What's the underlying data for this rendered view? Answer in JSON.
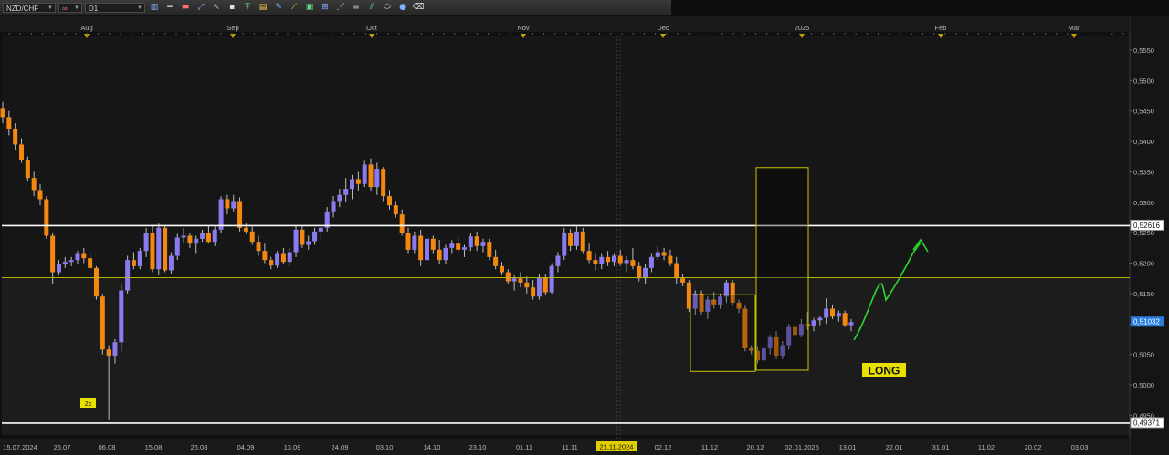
{
  "toolbar": {
    "symbol": "NZD/CHF",
    "timeframe": "D1",
    "icons": [
      "link-icon",
      "chart-type-icon",
      "horizontal-line-icon",
      "color-bar-icon",
      "zoom-icon",
      "cursor-icon",
      "crosshair-icon",
      "text-icon",
      "template-icon",
      "pencil-icon",
      "gann-icon",
      "screenshot-icon",
      "trend-line-icon",
      "dotted-line-icon",
      "fibonacci-icon",
      "channel-icon",
      "ellipse-icon",
      "sphere-icon",
      "eraser-icon"
    ]
  },
  "chart_data": {
    "type": "candlestick",
    "symbol": "NZD/CHF",
    "timeframe": "D1",
    "month_labels": [
      "Aug",
      "Sep",
      "Oct",
      "Nov",
      "Dec",
      "2025",
      "Feb",
      "Mar"
    ],
    "x_tick_labels": [
      "15.07.2024",
      "26.07",
      "06.08",
      "15.08",
      "26.08",
      "04.09",
      "13.09",
      "24.09",
      "03.10",
      "14.10",
      "23.10",
      "01.11",
      "11.11",
      "21.11.2024",
      "02.12",
      "11.12",
      "20.12",
      "02.01.2025",
      "13.01",
      "22.01",
      "31.01",
      "11.02",
      "20.02",
      "03.03"
    ],
    "y_tick_labels": [
      "0,5550",
      "0,5500",
      "0,5450",
      "0,5400",
      "0,5350",
      "0,5300",
      "0,5250",
      "0,5200",
      "0,5150",
      "0,5100",
      "0,5050",
      "0,5000",
      "0,4950"
    ],
    "ylim": [
      0.4913,
      0.5562
    ],
    "price_labels": {
      "upper_line": "0,52616",
      "current": "0,51032",
      "lower_line": "0,49371"
    },
    "horizontal_levels": [
      {
        "value": 0.52616,
        "color": "#ffffff"
      },
      {
        "value": 0.5176,
        "color": "#b5b500"
      },
      {
        "value": 0.49371,
        "color": "#ffffff"
      }
    ],
    "cursor_date": "21.11.2024",
    "annotations": {
      "long_label": "LONG",
      "marker_2x": "2x"
    },
    "candles": [
      [
        0.5455,
        0.5465,
        0.543,
        0.544
      ],
      [
        0.544,
        0.545,
        0.541,
        0.542
      ],
      [
        0.542,
        0.543,
        0.5385,
        0.5395
      ],
      [
        0.5395,
        0.5405,
        0.5365,
        0.537
      ],
      [
        0.537,
        0.5375,
        0.5335,
        0.534
      ],
      [
        0.534,
        0.535,
        0.531,
        0.532
      ],
      [
        0.532,
        0.533,
        0.5295,
        0.5305
      ],
      [
        0.5305,
        0.531,
        0.524,
        0.5245
      ],
      [
        0.5245,
        0.525,
        0.5165,
        0.5185
      ],
      [
        0.5185,
        0.5205,
        0.518,
        0.5198
      ],
      [
        0.5198,
        0.521,
        0.5192,
        0.5202
      ],
      [
        0.5202,
        0.521,
        0.5195,
        0.5205
      ],
      [
        0.5205,
        0.522,
        0.5198,
        0.5215
      ],
      [
        0.5215,
        0.5225,
        0.52,
        0.5208
      ],
      [
        0.5208,
        0.5215,
        0.519,
        0.5192
      ],
      [
        0.5192,
        0.5195,
        0.514,
        0.5145
      ],
      [
        0.5145,
        0.515,
        0.505,
        0.5058
      ],
      [
        0.5058,
        0.5065,
        0.4942,
        0.5048
      ],
      [
        0.5048,
        0.5075,
        0.5035,
        0.507
      ],
      [
        0.507,
        0.5165,
        0.5055,
        0.5155
      ],
      [
        0.5155,
        0.5212,
        0.515,
        0.5205
      ],
      [
        0.5205,
        0.5218,
        0.519,
        0.5195
      ],
      [
        0.5195,
        0.5225,
        0.519,
        0.522
      ],
      [
        0.522,
        0.5258,
        0.521,
        0.525
      ],
      [
        0.525,
        0.5262,
        0.5185,
        0.519
      ],
      [
        0.519,
        0.5265,
        0.518,
        0.5258
      ],
      [
        0.5258,
        0.5262,
        0.5185,
        0.5188
      ],
      [
        0.5188,
        0.5218,
        0.5182,
        0.5212
      ],
      [
        0.5212,
        0.5248,
        0.5205,
        0.5242
      ],
      [
        0.5242,
        0.5258,
        0.5232,
        0.5245
      ],
      [
        0.5245,
        0.525,
        0.5225,
        0.5232
      ],
      [
        0.5232,
        0.5245,
        0.5215,
        0.524
      ],
      [
        0.524,
        0.5255,
        0.5235,
        0.525
      ],
      [
        0.525,
        0.5262,
        0.5232,
        0.5235
      ],
      [
        0.5235,
        0.526,
        0.5228,
        0.5255
      ],
      [
        0.5255,
        0.531,
        0.525,
        0.5305
      ],
      [
        0.5305,
        0.5312,
        0.528,
        0.529
      ],
      [
        0.529,
        0.5312,
        0.5285,
        0.5302
      ],
      [
        0.5302,
        0.5308,
        0.5252,
        0.5258
      ],
      [
        0.5258,
        0.5265,
        0.5248,
        0.5252
      ],
      [
        0.5252,
        0.526,
        0.523,
        0.5235
      ],
      [
        0.5235,
        0.5245,
        0.5212,
        0.522
      ],
      [
        0.522,
        0.5232,
        0.52,
        0.5205
      ],
      [
        0.5205,
        0.521,
        0.519,
        0.5196
      ],
      [
        0.5196,
        0.522,
        0.5192,
        0.5215
      ],
      [
        0.5215,
        0.5225,
        0.5198,
        0.5202
      ],
      [
        0.5202,
        0.5225,
        0.5195,
        0.5218
      ],
      [
        0.5218,
        0.5262,
        0.521,
        0.5255
      ],
      [
        0.5255,
        0.5262,
        0.5225,
        0.523
      ],
      [
        0.523,
        0.5245,
        0.5222,
        0.5236
      ],
      [
        0.5236,
        0.5258,
        0.523,
        0.5252
      ],
      [
        0.5252,
        0.5262,
        0.524,
        0.5258
      ],
      [
        0.5258,
        0.5292,
        0.5252,
        0.5285
      ],
      [
        0.5285,
        0.531,
        0.5275,
        0.5302
      ],
      [
        0.5302,
        0.5322,
        0.5292,
        0.5312
      ],
      [
        0.5312,
        0.534,
        0.53,
        0.5322
      ],
      [
        0.5322,
        0.5345,
        0.5305,
        0.5338
      ],
      [
        0.5338,
        0.535,
        0.5318,
        0.533
      ],
      [
        0.533,
        0.5368,
        0.5325,
        0.5362
      ],
      [
        0.5362,
        0.5372,
        0.5318,
        0.5325
      ],
      [
        0.5325,
        0.5365,
        0.5312,
        0.5355
      ],
      [
        0.5355,
        0.5358,
        0.5302,
        0.531
      ],
      [
        0.531,
        0.532,
        0.5288,
        0.5295
      ],
      [
        0.5295,
        0.5302,
        0.5275,
        0.528
      ],
      [
        0.528,
        0.5288,
        0.5245,
        0.525
      ],
      [
        0.525,
        0.5258,
        0.5215,
        0.5222
      ],
      [
        0.5222,
        0.5252,
        0.5215,
        0.5245
      ],
      [
        0.5245,
        0.5255,
        0.5195,
        0.5205
      ],
      [
        0.5205,
        0.525,
        0.5198,
        0.524
      ],
      [
        0.524,
        0.5245,
        0.5215,
        0.5222
      ],
      [
        0.5222,
        0.5238,
        0.5198,
        0.5205
      ],
      [
        0.5205,
        0.523,
        0.5198,
        0.5225
      ],
      [
        0.5225,
        0.5238,
        0.5215,
        0.5232
      ],
      [
        0.5232,
        0.5242,
        0.5215,
        0.5222
      ],
      [
        0.5222,
        0.523,
        0.521,
        0.5226
      ],
      [
        0.5226,
        0.525,
        0.522,
        0.5244
      ],
      [
        0.5244,
        0.5252,
        0.522,
        0.5228
      ],
      [
        0.5228,
        0.524,
        0.5218,
        0.5235
      ],
      [
        0.5235,
        0.524,
        0.5205,
        0.521
      ],
      [
        0.521,
        0.5222,
        0.519,
        0.5195
      ],
      [
        0.5195,
        0.5202,
        0.518,
        0.5185
      ],
      [
        0.5185,
        0.519,
        0.5165,
        0.517
      ],
      [
        0.517,
        0.518,
        0.5155,
        0.5175
      ],
      [
        0.5175,
        0.5185,
        0.516,
        0.5168
      ],
      [
        0.5168,
        0.5178,
        0.515,
        0.516
      ],
      [
        0.516,
        0.5172,
        0.514,
        0.5145
      ],
      [
        0.5145,
        0.5182,
        0.514,
        0.5176
      ],
      [
        0.5176,
        0.5182,
        0.5148,
        0.5152
      ],
      [
        0.5152,
        0.52,
        0.515,
        0.5195
      ],
      [
        0.5195,
        0.5218,
        0.5185,
        0.5212
      ],
      [
        0.5212,
        0.5258,
        0.5205,
        0.525
      ],
      [
        0.525,
        0.5256,
        0.522,
        0.5228
      ],
      [
        0.5228,
        0.526,
        0.5222,
        0.5252
      ],
      [
        0.5252,
        0.5258,
        0.5215,
        0.522
      ],
      [
        0.522,
        0.5232,
        0.52,
        0.5205
      ],
      [
        0.5205,
        0.5215,
        0.5188,
        0.5198
      ],
      [
        0.5198,
        0.5215,
        0.519,
        0.521
      ],
      [
        0.521,
        0.522,
        0.5195,
        0.5202
      ],
      [
        0.5202,
        0.5215,
        0.5195,
        0.5212
      ],
      [
        0.5212,
        0.5222,
        0.5196,
        0.52
      ],
      [
        0.52,
        0.5212,
        0.5185,
        0.5205
      ],
      [
        0.5205,
        0.5225,
        0.519,
        0.5195
      ],
      [
        0.5195,
        0.5202,
        0.517,
        0.5175
      ],
      [
        0.5175,
        0.5198,
        0.5165,
        0.5192
      ],
      [
        0.5192,
        0.5215,
        0.5185,
        0.521
      ],
      [
        0.521,
        0.5228,
        0.5205,
        0.5218
      ],
      [
        0.5218,
        0.5225,
        0.5205,
        0.5212
      ],
      [
        0.5212,
        0.5222,
        0.5195,
        0.52
      ],
      [
        0.52,
        0.521,
        0.5165,
        0.5175
      ],
      [
        0.5175,
        0.5182,
        0.5162,
        0.5168
      ],
      [
        0.5168,
        0.5172,
        0.512,
        0.5125
      ],
      [
        0.5125,
        0.5155,
        0.5115,
        0.515
      ],
      [
        0.515,
        0.5155,
        0.5115,
        0.512
      ],
      [
        0.512,
        0.5145,
        0.5108,
        0.514
      ],
      [
        0.514,
        0.5152,
        0.5125,
        0.5132
      ],
      [
        0.5132,
        0.515,
        0.5125,
        0.5145
      ],
      [
        0.5145,
        0.5172,
        0.5135,
        0.5168
      ],
      [
        0.5168,
        0.5172,
        0.513,
        0.5135
      ],
      [
        0.5135,
        0.514,
        0.5118,
        0.5125
      ],
      [
        0.5125,
        0.513,
        0.5055,
        0.506
      ],
      [
        0.506,
        0.5065,
        0.505,
        0.5056
      ],
      [
        0.5056,
        0.5062,
        0.5035,
        0.504
      ],
      [
        0.504,
        0.5065,
        0.5035,
        0.506
      ],
      [
        0.506,
        0.5082,
        0.505,
        0.5078
      ],
      [
        0.5078,
        0.5088,
        0.5042,
        0.5048
      ],
      [
        0.5048,
        0.5072,
        0.5042,
        0.5065
      ],
      [
        0.5065,
        0.51,
        0.5058,
        0.5095
      ],
      [
        0.5095,
        0.5102,
        0.5075,
        0.5082
      ],
      [
        0.5082,
        0.5108,
        0.5078,
        0.51
      ],
      [
        0.51,
        0.512,
        0.509,
        0.5096
      ],
      [
        0.5096,
        0.511,
        0.5088,
        0.5106
      ],
      [
        0.5106,
        0.5112,
        0.5098,
        0.511
      ],
      [
        0.511,
        0.5142,
        0.51,
        0.5125
      ],
      [
        0.5125,
        0.5132,
        0.5108,
        0.5112
      ],
      [
        0.5112,
        0.5122,
        0.5104,
        0.5118
      ],
      [
        0.5118,
        0.5122,
        0.5095,
        0.5098
      ],
      [
        0.5098,
        0.5108,
        0.5088,
        0.5103
      ]
    ]
  }
}
